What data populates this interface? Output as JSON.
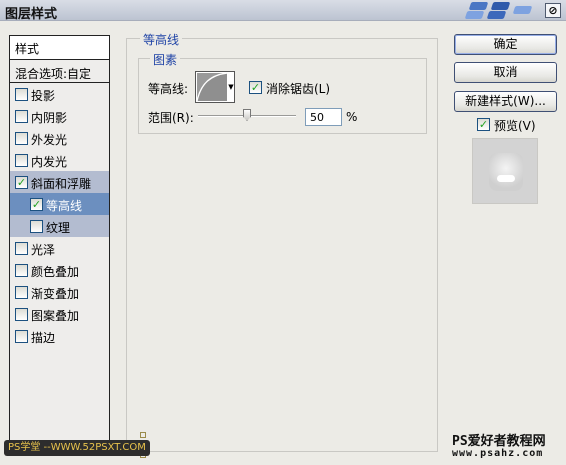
{
  "window": {
    "title": "图层样式",
    "close_glyph": "⊘",
    "logo_colors": [
      "#4a76c4",
      "#2f5aab",
      "#7ea2e0",
      "#3c68bb"
    ]
  },
  "styles_list": {
    "header": "样式",
    "blend_options": "混合选项:自定",
    "items": [
      {
        "label": "投影",
        "checked": false
      },
      {
        "label": "内阴影",
        "checked": false
      },
      {
        "label": "外发光",
        "checked": false
      },
      {
        "label": "内发光",
        "checked": false
      },
      {
        "label": "斜面和浮雕",
        "checked": true
      },
      {
        "label": "等高线",
        "checked": true
      },
      {
        "label": "纹理",
        "checked": false
      },
      {
        "label": "光泽",
        "checked": false
      },
      {
        "label": "颜色叠加",
        "checked": false
      },
      {
        "label": "渐变叠加",
        "checked": false
      },
      {
        "label": "图案叠加",
        "checked": false
      },
      {
        "label": "描边",
        "checked": false
      }
    ]
  },
  "contour_panel": {
    "group_title": "等高线",
    "sub_group_title": "图素",
    "contour_label": "等高线:",
    "antialias_label": "消除锯齿(L)",
    "antialias_checked": true,
    "range_label": "范围(R):",
    "range_value": "50",
    "range_unit": "%",
    "range_percent": 50
  },
  "buttons": {
    "ok": "确定",
    "cancel": "取消",
    "new_style": "新建样式(W)...",
    "preview_label": "预览(V)",
    "preview_checked": true
  },
  "watermarks": {
    "site_cn": "PS爱好者教程网",
    "site_url": "www.psahz.com",
    "left_badge": "PS学堂 --WWW.52PSXT.COM"
  },
  "colors": {
    "accent_blue": "#1f43a6",
    "selected_row": "#6c8fbf",
    "check_green": "#21a121"
  }
}
